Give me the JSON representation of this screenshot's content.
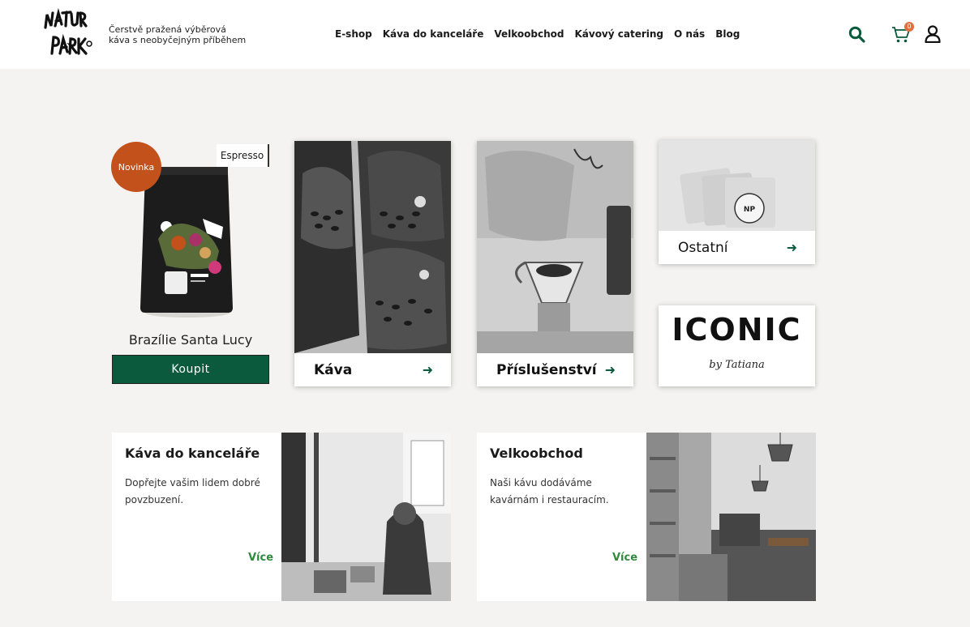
{
  "header": {
    "tagline": "Čerstvě pražená výběrová káva s neobyčejným příběhem",
    "nav": [
      "E-shop",
      "Káva do kanceláře",
      "Velkoobchod",
      "Kávový catering",
      "O nás",
      "Blog"
    ],
    "cart_count": "0",
    "accent_color": "#0c5a3e"
  },
  "product": {
    "badge": "Novinka",
    "tag": "Espresso",
    "name": "Brazílie Santa Lucy",
    "button": "Koupit"
  },
  "tiles": {
    "kava": "Káva",
    "prislusenstvi": "Příslušenství",
    "ostatni": "Ostatní",
    "iconic_logo": "ICONIC",
    "iconic_sub": "by Tatiana"
  },
  "promos": [
    {
      "title": "Káva do kanceláře",
      "desc": "Dopřejte vašim lidem dobré povzbuzení.",
      "more": "Více"
    },
    {
      "title": "Velkoobchod",
      "desc": "Naši kávu dodáváme kavárnám i restauracím.",
      "more": "Více"
    }
  ]
}
